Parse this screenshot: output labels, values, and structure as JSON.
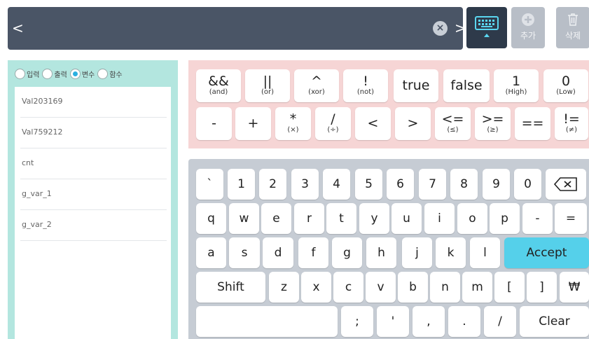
{
  "topbar": {
    "back": "<",
    "clear": "×",
    "forward": ">"
  },
  "toolbar": {
    "add_label": "추가",
    "delete_label": "삭제"
  },
  "modes": [
    {
      "label": "입력",
      "selected": false
    },
    {
      "label": "출력",
      "selected": false
    },
    {
      "label": "변수",
      "selected": true
    },
    {
      "label": "함수",
      "selected": false
    }
  ],
  "variables": [
    "Val203169",
    "Val759212",
    "cnt",
    "g_var_1",
    "g_var_2"
  ],
  "operators": {
    "row1": [
      {
        "main": "&&",
        "sub": "(and)"
      },
      {
        "main": "||",
        "sub": "(or)"
      },
      {
        "main": "^",
        "sub": "(xor)"
      },
      {
        "main": "!",
        "sub": "(not)"
      },
      {
        "main": "true",
        "sub": ""
      },
      {
        "main": "false",
        "sub": ""
      },
      {
        "main": "1",
        "sub": "(High)"
      },
      {
        "main": "0",
        "sub": "(Low)"
      }
    ],
    "row2": [
      {
        "main": "-",
        "sub": ""
      },
      {
        "main": "+",
        "sub": ""
      },
      {
        "main": "*",
        "sub": "(×)"
      },
      {
        "main": "/",
        "sub": "(÷)"
      },
      {
        "main": "<",
        "sub": ""
      },
      {
        "main": ">",
        "sub": ""
      },
      {
        "main": "<=",
        "sub": "(≤)"
      },
      {
        "main": ">=",
        "sub": "(≥)"
      },
      {
        "main": "==",
        "sub": ""
      },
      {
        "main": "!=",
        "sub": "(≠)"
      }
    ]
  },
  "keyboard": {
    "row1": [
      "`",
      "1",
      "2",
      "3",
      "4",
      "5",
      "6",
      "7",
      "8",
      "9",
      "0"
    ],
    "row2": [
      "q",
      "w",
      "e",
      "r",
      "t",
      "y",
      "u",
      "i",
      "o",
      "p",
      "-",
      "="
    ],
    "row3": [
      "a",
      "s",
      "d",
      "f",
      "g",
      "h",
      "j",
      "k",
      "l"
    ],
    "accept": "Accept",
    "shift": "Shift",
    "row4": [
      "z",
      "x",
      "c",
      "v",
      "b",
      "n",
      "m",
      "[",
      "]",
      "₩"
    ],
    "row5": [
      ";",
      "'",
      ",",
      ".",
      "/"
    ],
    "clear": "Clear",
    "icons": {
      "backspace": "backspace-icon",
      "keyboard": "keyboard-icon",
      "add": "plus-circle-icon",
      "delete": "trash-icon"
    }
  }
}
